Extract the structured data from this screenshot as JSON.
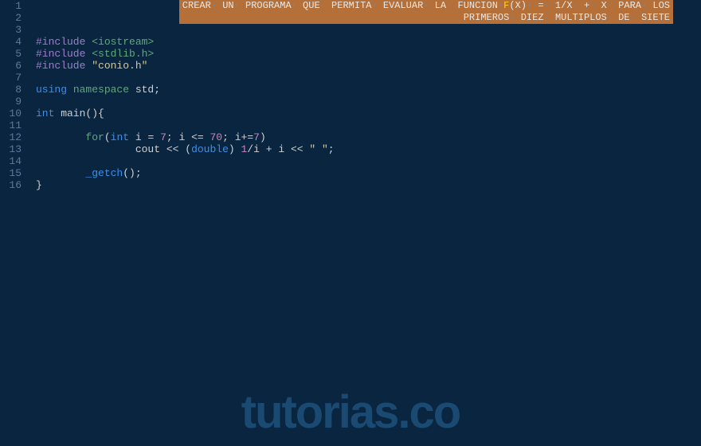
{
  "comment": {
    "line1_parts": [
      "CREAR",
      " UN",
      " PROGRAMA",
      " QUE",
      " PERMITA",
      " EVALUAR",
      " LA",
      " FUNCION",
      " ",
      "F",
      "(X)",
      " =",
      " 1/X",
      " +",
      " X",
      " PARA",
      " LOS"
    ],
    "line2_parts": [
      "PRIMEROS",
      " DIEZ",
      " MULTIPLOS",
      " DE",
      " SIETE"
    ]
  },
  "code": {
    "include1_hash": "#include ",
    "include1_lib": "<iostream>",
    "include2_hash": "#include ",
    "include2_lib": "<stdlib.h>",
    "include3_hash": "#include ",
    "include3_lib": "\"conio.h\"",
    "using": "using",
    "namespace": " namespace",
    "std": " std",
    "semi": ";",
    "int_type": "int",
    "main": " main",
    "main_parens": "()",
    "brace_open": "{",
    "for": "for",
    "for_open": "(",
    "for_int": "int",
    "for_var": " i ",
    "for_eq": "= ",
    "for_7": "7",
    "for_semi1": "; ",
    "for_cond_i": "i ",
    "for_cond_op": "<= ",
    "for_70": "70",
    "for_semi2": "; ",
    "for_inc_i": "i",
    "for_inc_op": "+=",
    "for_inc_7": "7",
    "for_close": ")",
    "cout": "cout ",
    "stream1": "<< ",
    "cast_open": "(",
    "cast_type": "double",
    "cast_close": ") ",
    "one": "1",
    "div": "/",
    "i1": "i ",
    "plus": "+ ",
    "i2": "i ",
    "stream2": "<< ",
    "space_str": "\" \"",
    "getch": "_getch",
    "getch_parens": "()",
    "brace_close": "}"
  },
  "line_numbers": [
    "1",
    "2",
    "3",
    "4",
    "5",
    "6",
    "7",
    "8",
    "9",
    "10",
    "11",
    "12",
    "13",
    "14",
    "15",
    "16"
  ],
  "watermark": "tutorias.co"
}
